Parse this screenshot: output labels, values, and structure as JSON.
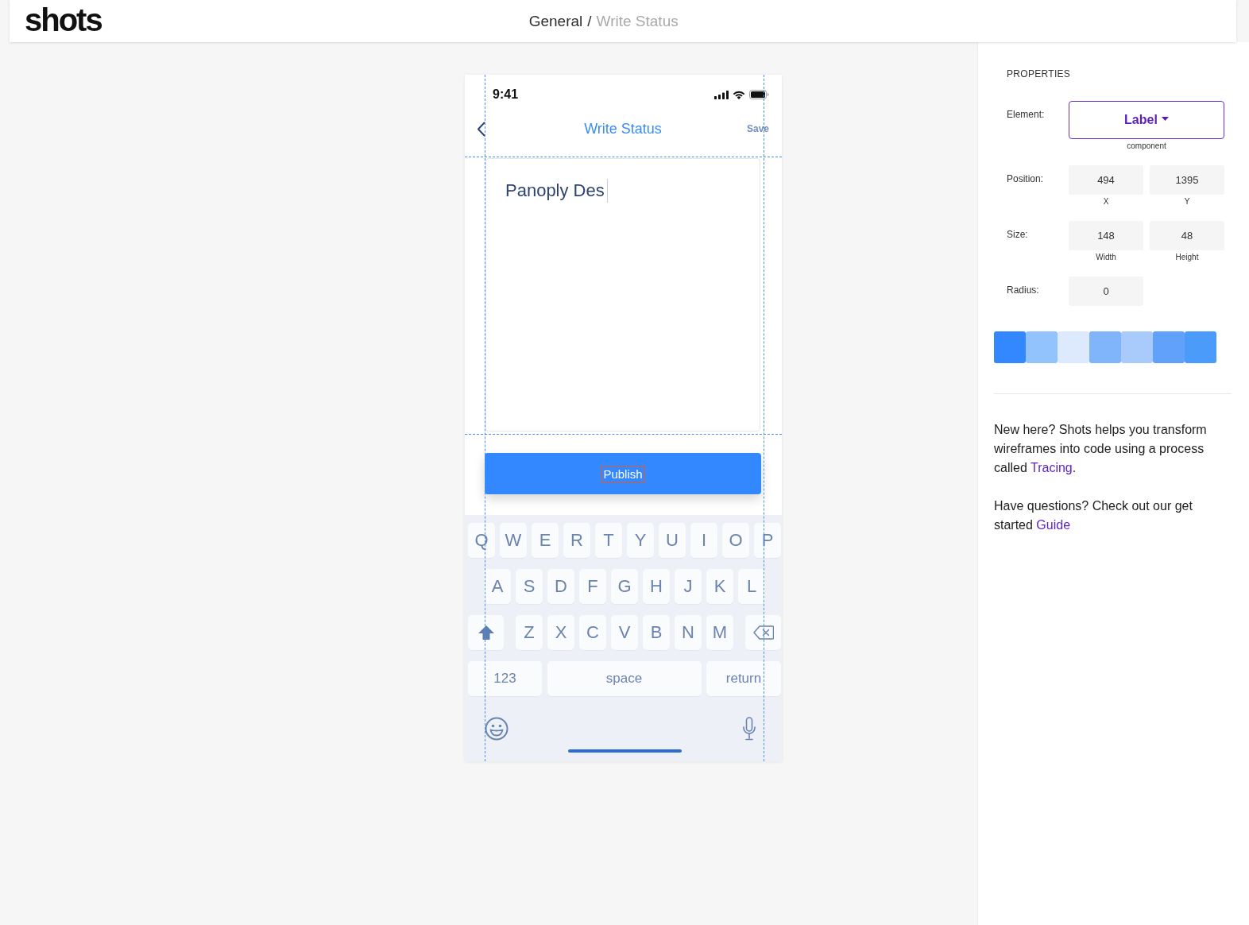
{
  "header": {
    "logo": "shots",
    "breadcrumb": [
      {
        "label": "General",
        "current": false
      },
      {
        "label": "Write Status",
        "current": true
      }
    ],
    "separator": "/"
  },
  "phone": {
    "status_bar": {
      "time": "9:41"
    },
    "nav": {
      "title": "Write Status",
      "action": "Save"
    },
    "editor": {
      "value": "Panoply Des",
      "focused": true
    },
    "primary_button": {
      "label": "Publish",
      "selected": true
    },
    "keyboard": {
      "rows": [
        {
          "keys": [
            {
              "kind": "char",
              "label": "Q"
            },
            {
              "kind": "char",
              "label": "W"
            },
            {
              "kind": "char",
              "label": "E"
            },
            {
              "kind": "char",
              "label": "R"
            },
            {
              "kind": "char",
              "label": "T"
            },
            {
              "kind": "char",
              "label": "Y"
            },
            {
              "kind": "char",
              "label": "U"
            },
            {
              "kind": "char",
              "label": "I"
            },
            {
              "kind": "char",
              "label": "O"
            },
            {
              "kind": "char",
              "label": "P"
            }
          ]
        },
        {
          "keys": [
            {
              "kind": "char",
              "label": "A"
            },
            {
              "kind": "char",
              "label": "S"
            },
            {
              "kind": "char",
              "label": "D"
            },
            {
              "kind": "char",
              "label": "F"
            },
            {
              "kind": "char",
              "label": "G"
            },
            {
              "kind": "char",
              "label": "H"
            },
            {
              "kind": "char",
              "label": "J"
            },
            {
              "kind": "char",
              "label": "K"
            },
            {
              "kind": "char",
              "label": "L"
            }
          ]
        },
        {
          "keys": [
            {
              "kind": "shift"
            },
            {
              "kind": "char",
              "label": "Z"
            },
            {
              "kind": "char",
              "label": "X"
            },
            {
              "kind": "char",
              "label": "C"
            },
            {
              "kind": "char",
              "label": "V"
            },
            {
              "kind": "char",
              "label": "B"
            },
            {
              "kind": "char",
              "label": "N"
            },
            {
              "kind": "char",
              "label": "M"
            },
            {
              "kind": "delete"
            }
          ]
        },
        {
          "keys": [
            {
              "kind": "mode",
              "label": "123"
            },
            {
              "kind": "space",
              "label": "space"
            },
            {
              "kind": "return",
              "label": "return"
            }
          ]
        }
      ]
    }
  },
  "properties": {
    "heading": "PROPERTIES",
    "fields": [
      {
        "kind": "select",
        "label": "Element:",
        "value": "Label",
        "caption": "component"
      },
      {
        "kind": "numbers",
        "label": "Position:",
        "inputs": [
          {
            "value": "494",
            "caption": "X"
          },
          {
            "value": "1395",
            "caption": "Y"
          }
        ]
      },
      {
        "kind": "numbers",
        "label": "Size:",
        "inputs": [
          {
            "value": "148",
            "caption": "Width"
          },
          {
            "value": "48",
            "caption": "Height"
          }
        ]
      },
      {
        "kind": "numbers",
        "label": "Radius:",
        "inputs": [
          {
            "value": "0"
          }
        ]
      }
    ],
    "swatches": [
      {
        "color": "#3388ff"
      },
      {
        "color": "#93c3fd"
      },
      {
        "color": "#ddeafd"
      },
      {
        "color": "#80b4fb"
      },
      {
        "color": "#a9cbfb"
      },
      {
        "color": "#61a1fa"
      },
      {
        "color": "#4b9cfa"
      }
    ],
    "help": [
      {
        "text": "New here? Shots helps you transform wireframes into code using a process called ",
        "link": "Tracing",
        "after": "."
      },
      {
        "text": "Have questions? Check out our get started ",
        "link": "Guide"
      }
    ]
  }
}
